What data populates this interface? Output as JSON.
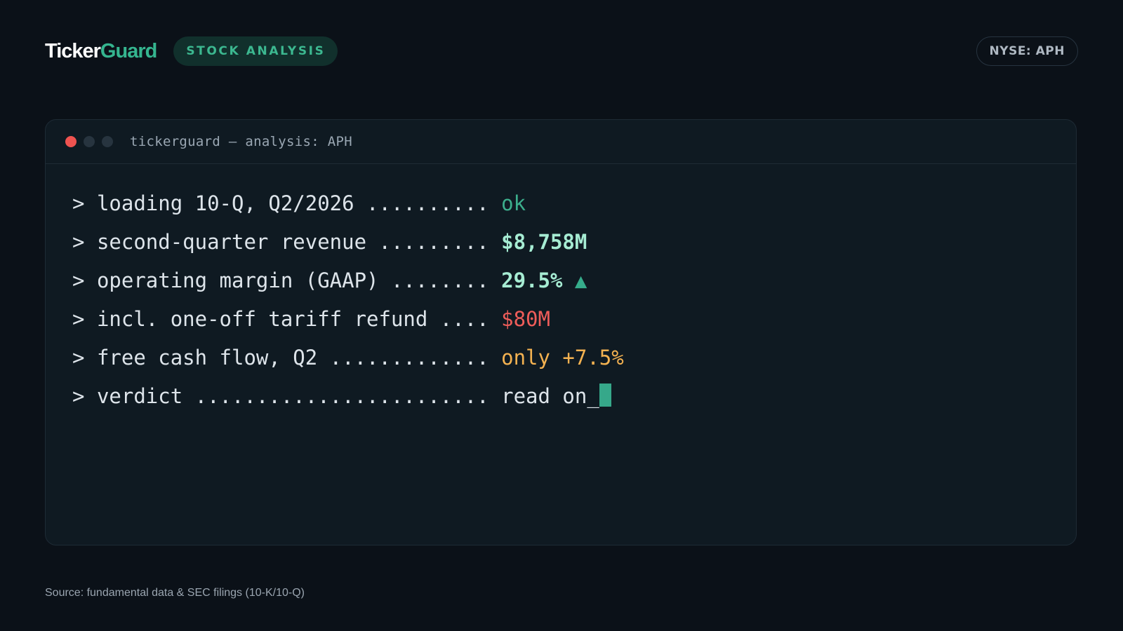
{
  "header": {
    "brand_part1": "Ticker",
    "brand_part2": "Guard",
    "tag": "STOCK ANALYSIS",
    "ticker": "NYSE: APH"
  },
  "terminal": {
    "title": "tickerguard — analysis: APH",
    "prompt": ">",
    "lines": [
      {
        "label": "loading 10-Q, Q2/2026 .......... ",
        "value": "ok"
      },
      {
        "label": "second-quarter revenue ......... ",
        "value": "$8,758M"
      },
      {
        "label": "operating margin (GAAP) ........ ",
        "value": "29.5%",
        "indicator": "▲"
      },
      {
        "label": "incl. one-off tariff refund .... ",
        "value": "$80M"
      },
      {
        "label": "free cash flow, Q2 ............. ",
        "value": "only +7.5%"
      },
      {
        "label": "verdict ........................ ",
        "value": "read on_"
      }
    ],
    "colors": {
      "ok": "#3cae8c",
      "highlight": "#a6ecd3",
      "negative": "#ef5d5a",
      "warning": "#f4b251",
      "accent": "#36a88a"
    }
  },
  "footer": {
    "source": "Source: fundamental data & SEC filings (10-K/10-Q)"
  }
}
